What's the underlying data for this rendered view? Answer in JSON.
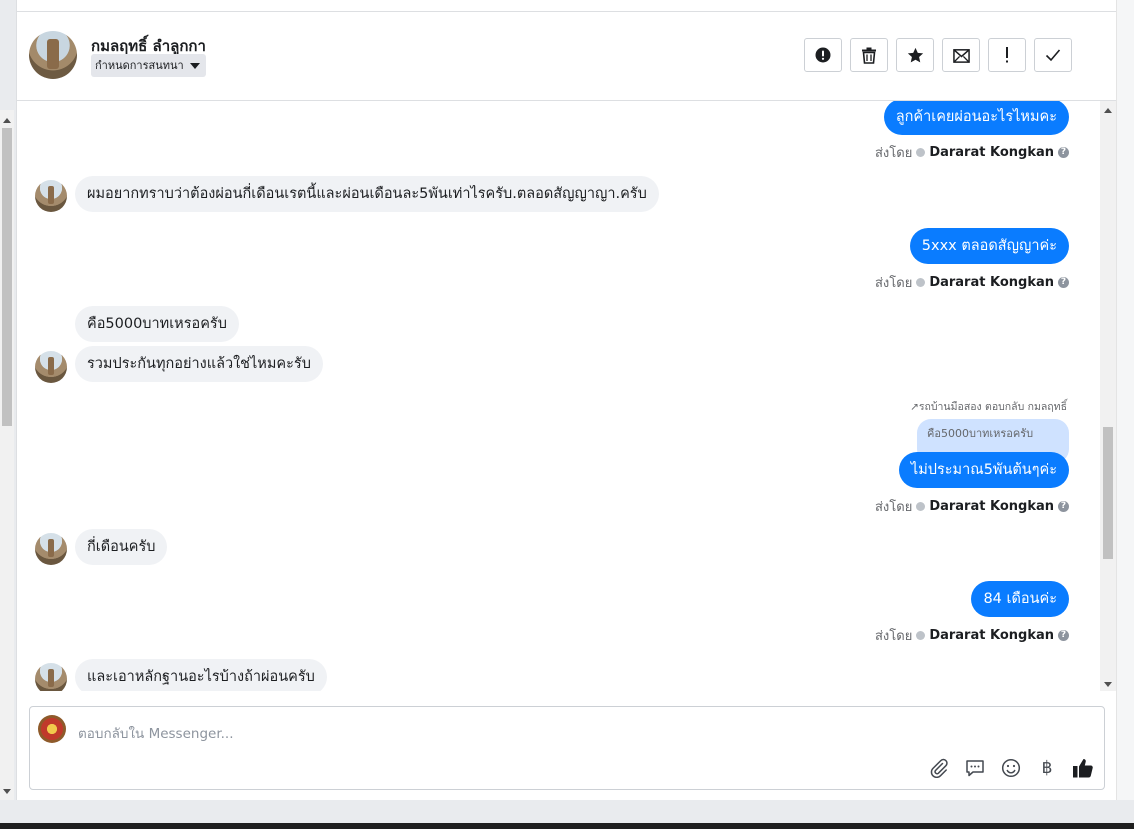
{
  "header": {
    "contact_name": "กมลฤทธิ์ ลำลูกกา",
    "assign_label": "กำหนดการสนทนา",
    "actions": [
      {
        "icon": "alert-circle-icon"
      },
      {
        "icon": "trash-icon"
      },
      {
        "icon": "star-icon"
      },
      {
        "icon": "mark-unread-icon"
      },
      {
        "icon": "exclamation-icon"
      },
      {
        "icon": "checkmark-icon"
      }
    ]
  },
  "messages": {
    "m1": {
      "text": "ลูกค้าเคยผ่อนอะไรไหมคะ",
      "sent_by_label": "ส่งโดย",
      "agent": "Dararat Kongkan"
    },
    "m2": {
      "text": "ผมอยากทราบว่าต้องผ่อนกี่เดือนเรตนี้และผ่อนเดือนละ5พันเท่าไรครับ.ตลอดสัญญาญา.ครับ"
    },
    "m3": {
      "text": "5xxx ตลอดสัญญาค่ะ",
      "sent_by_label": "ส่งโดย",
      "agent": "Dararat Kongkan"
    },
    "m4": {
      "text": "คือ5000บาทเหรอครับ"
    },
    "m5": {
      "text": "รวมประกันทุกอย่างแล้วใช่ไหมคะรับ"
    },
    "m6": {
      "reply_note": "↗รถบ้านมือสอง ตอบกลับ กมลฤทธิ์",
      "quoted": "คือ5000บาทเหรอครับ",
      "text": "ไม่ประมาณ5พันต้นๆค่ะ",
      "sent_by_label": "ส่งโดย",
      "agent": "Dararat Kongkan"
    },
    "m7": {
      "text": "กี่เดือนครับ"
    },
    "m8": {
      "text": "84 เดือนค่ะ",
      "sent_by_label": "ส่งโดย",
      "agent": "Dararat Kongkan"
    },
    "m9": {
      "text": "และเอาหลักฐานอะไรบ้างถ้าผ่อนครับ"
    }
  },
  "composer": {
    "placeholder": "ตอบกลับใน Messenger...",
    "tools": [
      "attachment-icon",
      "saved-replies-icon",
      "emoji-icon",
      "baht-icon",
      "thumbs-up-icon"
    ],
    "baht_symbol": "฿"
  },
  "colors": {
    "accent": "#0a7cff",
    "incoming_bg": "#f0f2f5",
    "quoted_bg": "#cfe2ff"
  }
}
